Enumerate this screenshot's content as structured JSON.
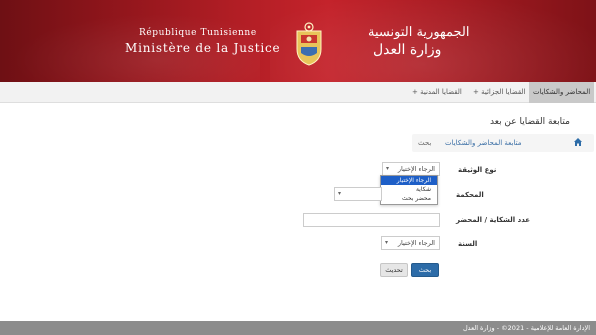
{
  "header": {
    "fr_line1": "République Tunisienne",
    "fr_line2": "Ministère de la Justice",
    "ar_line1": "الجمهورية التونسية",
    "ar_line2": "وزارة العدل",
    "banner_color": "#b21e25"
  },
  "nav": {
    "items": [
      {
        "label": "المحاضر والشكايات"
      },
      {
        "label": "القضايا الجزائية +"
      },
      {
        "label": "القضايا المدنية +"
      }
    ],
    "active_index": 0
  },
  "page": {
    "title": "متابعة القضايا عن بعد",
    "breadcrumb": {
      "home_icon": "home-icon",
      "link": "متابعة المحاضر والشكايات",
      "current": "بحث"
    }
  },
  "form": {
    "document_type": {
      "label": "نوع الوثيقة",
      "value": "الرجاء الإختيار",
      "options": [
        "الرجاء الإختيار",
        "شكاية",
        "محضر بحث"
      ],
      "highlighted_index": 0
    },
    "court": {
      "label": "المحكمة",
      "value": ""
    },
    "case_number": {
      "label": "عدد الشكاية / المحضر",
      "value": ""
    },
    "year": {
      "label": "السنة",
      "value": "الرجاء الإختيار"
    },
    "search_button": "بحث",
    "reset_button": "تحديث"
  },
  "footer": {
    "text": "الإدارة العامة للإعلامية - 2021© - وزارة العدل"
  },
  "colors": {
    "accent": "#2d6ca8",
    "link": "#3a6ea5",
    "dropdown_selected": "#1e5fc7",
    "footer_bg": "#8c8c8c"
  }
}
